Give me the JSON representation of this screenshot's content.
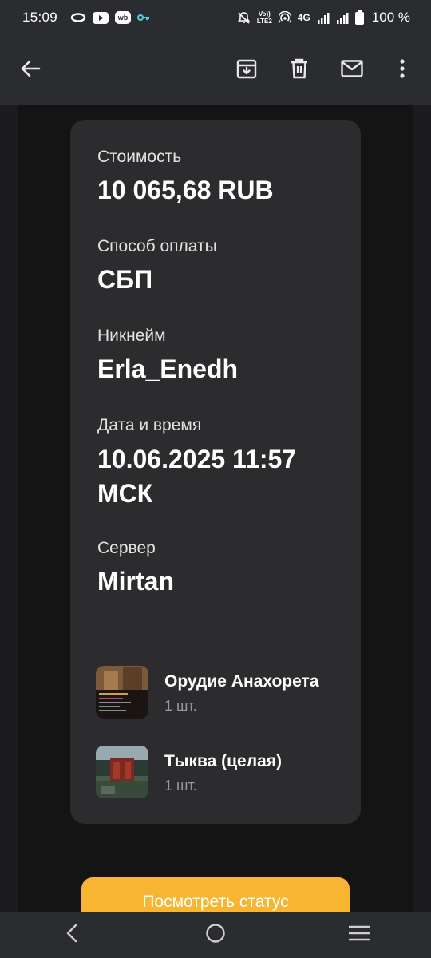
{
  "status_bar": {
    "time": "15:09",
    "app_badge": "wb",
    "volte": "Vo))",
    "lte": "LTE2",
    "network": "4G",
    "battery": "100 %"
  },
  "toolbar": {
    "icons": [
      "back-arrow-icon",
      "archive-icon",
      "delete-icon",
      "mark-unread-icon",
      "more-vert-icon"
    ]
  },
  "order": {
    "fields": [
      {
        "label": "Стоимость",
        "value": "10 065,68 RUB"
      },
      {
        "label": "Способ оплаты",
        "value": "СБП"
      },
      {
        "label": "Никнейм",
        "value": "Erla_Enedh"
      },
      {
        "label": "Дата и время",
        "value": "10.06.2025 11:57\nМСК"
      },
      {
        "label": "Сервер",
        "value": "Mirtan"
      }
    ],
    "products": [
      {
        "name": "Орудие Анахорета",
        "qty": "1 шт."
      },
      {
        "name": "Тыква (целая)",
        "qty": "1 шт."
      }
    ]
  },
  "status_button": {
    "label": "Посмотреть статус"
  },
  "nav_bar": {
    "icons": [
      "nav-back-icon",
      "nav-home-icon",
      "nav-recents-icon"
    ]
  },
  "colors": {
    "bar_bg": "#2b2c30",
    "page_bg": "#1c1c1e",
    "card_bg": "#2c2c2e",
    "accent": "#f7b531"
  }
}
